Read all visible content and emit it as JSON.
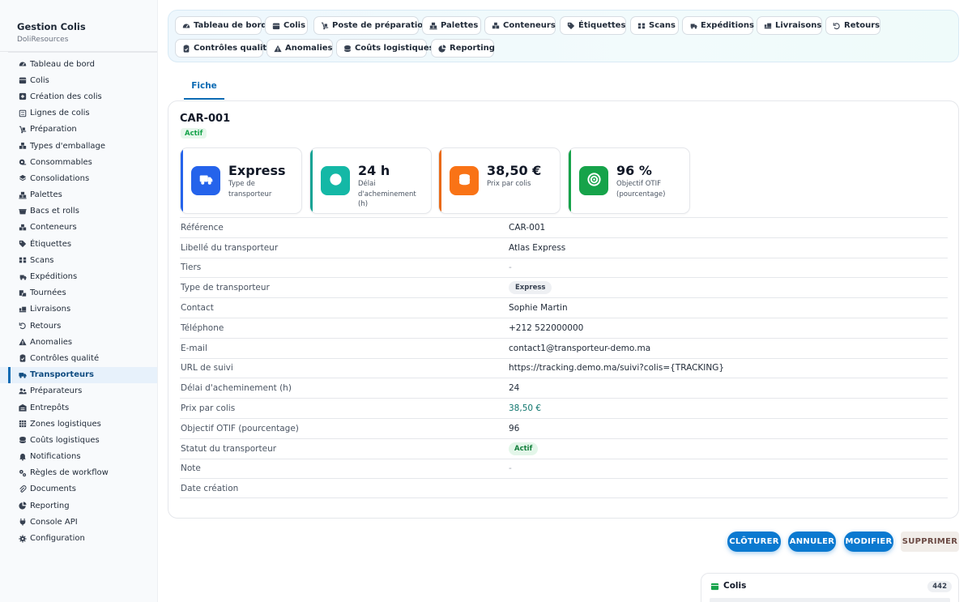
{
  "app": {
    "title": "Gestion Colis",
    "subtitle": "DoliResources"
  },
  "sidebar": {
    "items": [
      {
        "label": "Tableau de bord",
        "icon": "dashboard-icon"
      },
      {
        "label": "Colis",
        "icon": "box-icon"
      },
      {
        "label": "Création des colis",
        "icon": "plus-square-icon"
      },
      {
        "label": "Lignes de colis",
        "icon": "list-icon"
      },
      {
        "label": "Préparation",
        "icon": "dolly-icon"
      },
      {
        "label": "Types d'emballage",
        "icon": "boxes-icon"
      },
      {
        "label": "Consommables",
        "icon": "tape-icon"
      },
      {
        "label": "Consolidations",
        "icon": "layers-icon"
      },
      {
        "label": "Palettes",
        "icon": "pallet-icon"
      },
      {
        "label": "Bacs et rolls",
        "icon": "dumpster-icon"
      },
      {
        "label": "Conteneurs",
        "icon": "container-icon"
      },
      {
        "label": "Étiquettes",
        "icon": "tags-icon"
      },
      {
        "label": "Scans",
        "icon": "barcode-icon"
      },
      {
        "label": "Expéditions",
        "icon": "truck-fast-icon"
      },
      {
        "label": "Tournées",
        "icon": "route-icon"
      },
      {
        "label": "Livraisons",
        "icon": "delivery-icon"
      },
      {
        "label": "Retours",
        "icon": "undo-icon"
      },
      {
        "label": "Anomalies",
        "icon": "warning-icon"
      },
      {
        "label": "Contrôles qualité",
        "icon": "clipboard-check-icon"
      },
      {
        "label": "Transporteurs",
        "icon": "truck-icon"
      },
      {
        "label": "Préparateurs",
        "icon": "users-icon"
      },
      {
        "label": "Entrepôts",
        "icon": "warehouse-icon"
      },
      {
        "label": "Zones logistiques",
        "icon": "grid-icon"
      },
      {
        "label": "Coûts logistiques",
        "icon": "coins-icon"
      },
      {
        "label": "Notifications",
        "icon": "bell-icon"
      },
      {
        "label": "Règles de workflow",
        "icon": "cogs-icon"
      },
      {
        "label": "Documents",
        "icon": "paperclip-icon"
      },
      {
        "label": "Reporting",
        "icon": "chart-pie-icon"
      },
      {
        "label": "Console API",
        "icon": "plug-icon"
      },
      {
        "label": "Configuration",
        "icon": "gear-icon"
      }
    ],
    "active_index": 19
  },
  "topnav": {
    "items": [
      {
        "label": "Tableau de bord",
        "icon": "dashboard-icon"
      },
      {
        "label": "Colis",
        "icon": "box-icon"
      },
      {
        "label": "Poste de préparation",
        "icon": "dolly-icon"
      },
      {
        "label": "Palettes",
        "icon": "pallet-icon"
      },
      {
        "label": "Conteneurs",
        "icon": "container-icon"
      },
      {
        "label": "Étiquettes",
        "icon": "tags-icon"
      },
      {
        "label": "Scans",
        "icon": "barcode-icon"
      },
      {
        "label": "Expéditions",
        "icon": "truck-fast-icon"
      },
      {
        "label": "Livraisons",
        "icon": "delivery-icon"
      },
      {
        "label": "Retours",
        "icon": "undo-icon"
      },
      {
        "label": "Contrôles qualité",
        "icon": "clipboard-check-icon"
      },
      {
        "label": "Anomalies",
        "icon": "warning-icon"
      },
      {
        "label": "Coûts logistiques",
        "icon": "coins-icon"
      },
      {
        "label": "Reporting",
        "icon": "chart-pie-icon"
      }
    ]
  },
  "tabs": {
    "fiche": "Fiche"
  },
  "record": {
    "ref": "CAR-001",
    "status": "Actif",
    "kpis": [
      {
        "value": "Express",
        "label": "Type de transporteur",
        "icon": "truck-icon",
        "color": "#2563eb",
        "bar": "#2563eb"
      },
      {
        "value": "24 h",
        "label": "Délai d'acheminement (h)",
        "icon": "clock-icon",
        "color": "#14b8a6",
        "bar": "#14a394"
      },
      {
        "value": "38,50 €",
        "label": "Prix par colis",
        "icon": "coins-icon",
        "color": "#f97316",
        "bar": "#ea6a16"
      },
      {
        "value": "96 %",
        "label": "Objectif OTIF (pourcentage)",
        "icon": "target-icon",
        "color": "#16a34a",
        "bar": "#16a34a"
      }
    ],
    "fields": [
      {
        "label": "Référence",
        "value": "CAR-001",
        "kind": "text"
      },
      {
        "label": "Libellé du transporteur",
        "value": "Atlas Express",
        "kind": "text"
      },
      {
        "label": "Tiers",
        "value": "-",
        "kind": "muted"
      },
      {
        "label": "Type de transporteur",
        "value": "Express",
        "kind": "pill-grey"
      },
      {
        "label": "Contact",
        "value": "Sophie Martin",
        "kind": "text"
      },
      {
        "label": "Téléphone",
        "value": "+212 522000000",
        "kind": "text"
      },
      {
        "label": "E-mail",
        "value": "contact1@transporteur-demo.ma",
        "kind": "text"
      },
      {
        "label": "URL de suivi",
        "value": "https://tracking.demo.ma/suivi?colis={TRACKING}",
        "kind": "text"
      },
      {
        "label": "Délai d'acheminement (h)",
        "value": "24",
        "kind": "text"
      },
      {
        "label": "Prix par colis",
        "value": "38,50 €",
        "kind": "price"
      },
      {
        "label": "Objectif OTIF (pourcentage)",
        "value": "96",
        "kind": "text"
      },
      {
        "label": "Statut du transporteur",
        "value": "Actif",
        "kind": "pill-green"
      },
      {
        "label": "Note",
        "value": "-",
        "kind": "muted"
      },
      {
        "label": "Date création",
        "value": "",
        "kind": "text"
      }
    ]
  },
  "actions": {
    "close": "CLÔTURER",
    "cancel": "ANNULER",
    "edit": "MODIFIER",
    "delete": "SUPPRIMER"
  },
  "panel": {
    "title": "Colis",
    "count": "442"
  }
}
